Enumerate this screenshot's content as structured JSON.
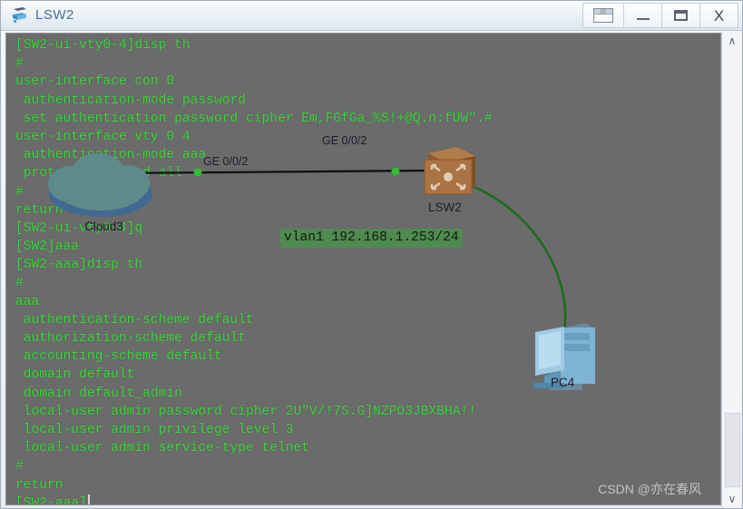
{
  "window": {
    "title": "LSW2",
    "icon": "switch-icon",
    "buttons": [
      {
        "name": "capture-button",
        "label": ""
      },
      {
        "name": "minimize-button",
        "label": ""
      },
      {
        "name": "maximize-button",
        "label": ""
      },
      {
        "name": "close-button",
        "label": "X"
      }
    ]
  },
  "terminal": {
    "fg_color": "#3cd63c",
    "bg_color": "#6b6b6b",
    "lines": [
      "[SW2-ui-vty0-4]disp th",
      "#",
      "user-interface con 0",
      " authentication-mode password",
      " set authentication password cipher Em,FGfGa_%S!+@Q.n:fUW\".#",
      "user-interface vty 0 4",
      " authentication-mode aaa",
      " protocol inbound all",
      "#",
      "return",
      "[SW2-ui-vty0-4]q",
      "[SW2]aaa",
      "[SW2-aaa]disp th",
      "#",
      "aaa",
      " authentication-scheme default",
      " authorization-scheme default",
      " accounting-scheme default",
      " domain default",
      " domain default_admin",
      " local-user admin password cipher 2U\"V/!7S.G]NZPO3JBXBHA!!",
      " local-user admin privilege level 3",
      " local-user admin service-type telnet",
      "#",
      "return"
    ],
    "prompt": "[SW2-aaa]"
  },
  "topology": {
    "cloud": {
      "label": "Cloud3",
      "color": "#5d8b8b"
    },
    "switch": {
      "label": "LSW2",
      "color": "#a06a3c"
    },
    "pc": {
      "label": "PC4",
      "color": "#7fb4d4"
    },
    "links": [
      {
        "name": "cloud-to-switch-link",
        "color": "#101010",
        "endpoint_a": "GE 0/0/2",
        "endpoint_b": "GE 0/0/2"
      },
      {
        "name": "switch-to-pc-link",
        "color": "#1d6b1d"
      }
    ],
    "interface_labels": [
      "GE 0/0/2",
      "GE 0/0/2"
    ],
    "vlan_annotation": "vlan1 192.168.1.253/24"
  },
  "scrollbar": {
    "up_arrow": "∧",
    "down_arrow": "∨"
  },
  "watermark": "CSDN @亦在春风"
}
